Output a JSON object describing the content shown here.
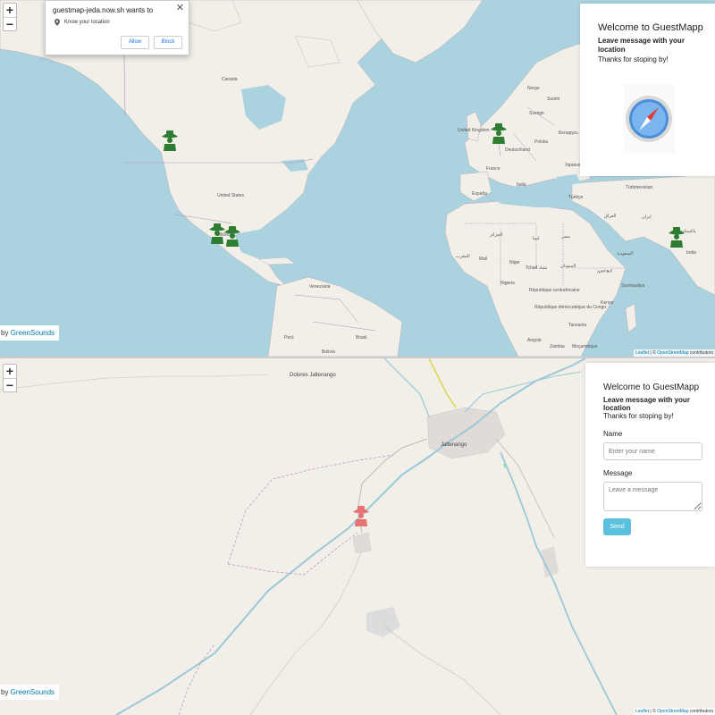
{
  "permission_prompt": {
    "title": "guestmap-jeda.now.sh wants to",
    "close": "✕",
    "permission": "Know your location",
    "allow_label": "Allow",
    "block_label": "Block"
  },
  "top_map": {
    "zoom_in": "+",
    "zoom_out": "−",
    "credit_prefix": "by ",
    "credit_link": "GreenSounds",
    "attribution_leaflet": "Leaflet",
    "attribution_text": " | © ",
    "attribution_osm": "OpenStreetMap",
    "attribution_suffix": " contributors",
    "labels": {
      "canada": "Canada",
      "united_states": "United States",
      "mexico": "México",
      "venezuela": "Venezuela",
      "peru": "Perú",
      "brasil": "Brasil",
      "bolivia": "Bolivia",
      "norge": "Norge",
      "suomi": "Suomi",
      "united_kingdom": "United Kingdom",
      "deutschland": "Deutschland",
      "france": "France",
      "espana": "España",
      "italia": "Italia",
      "ukraina": "Україна",
      "polska": "Polska",
      "turkiye": "Türkiye",
      "iraq": "العراق",
      "iran": "ایران",
      "turkmenistan": "Türkmenistan",
      "pakistan": "پاکستان",
      "india": "India",
      "algerie": "الجزائر",
      "libya": "ليبيا",
      "egypt": "مصر",
      "maroc": "المغرب",
      "mali": "Mali",
      "niger": "Niger",
      "chad": "Tchad تشاد",
      "sudan": "السودان",
      "nigeria": "Nigeria",
      "ethiopia": "ኢትዮጵያ",
      "car": "République centrafricaine",
      "congo": "République démocratique du Congo",
      "kenya": "Kenya",
      "tanzania": "Tanzania",
      "angola": "Angola",
      "zambia": "Zambia",
      "mocambique": "Moçambique",
      "saudi": "السعودية",
      "somalia": "Soomaaliya",
      "sverige": "Sverige",
      "belarus": "Беларусь"
    }
  },
  "top_welcome": {
    "title": "Welcome to GuestMapp",
    "subtitle": "Leave message with your location",
    "thanks": "Thanks for stoping by!"
  },
  "bottom_map": {
    "zoom_in": "+",
    "zoom_out": "−",
    "credit_prefix": "by ",
    "credit_link": "GreenSounds",
    "attribution_leaflet": "Leaflet",
    "attribution_text": " | © ",
    "attribution_osm": "OpenStreetMap",
    "attribution_suffix": " contributors",
    "labels": {
      "dolores": "Dolores Jaltenango",
      "jaltenango": "Jaltenango"
    }
  },
  "bottom_welcome": {
    "title": "Welcome to GuestMapp",
    "subtitle": "Leave message with your location",
    "thanks": "Thanks for stoping by!",
    "name_label": "Name",
    "name_placeholder": "Enter your name",
    "message_label": "Message",
    "message_placeholder": "Leave a message",
    "send_label": "Send"
  },
  "colors": {
    "water": "#aad3df",
    "land": "#f2efe9",
    "marker_green": "#2e7d32",
    "marker_red": "#e57373",
    "send_button": "#5bc0de",
    "link": "#0078a8"
  },
  "icons": {
    "marker": "mariachi-marker-icon",
    "compass": "safari-compass-icon",
    "location": "location-pin-icon"
  }
}
